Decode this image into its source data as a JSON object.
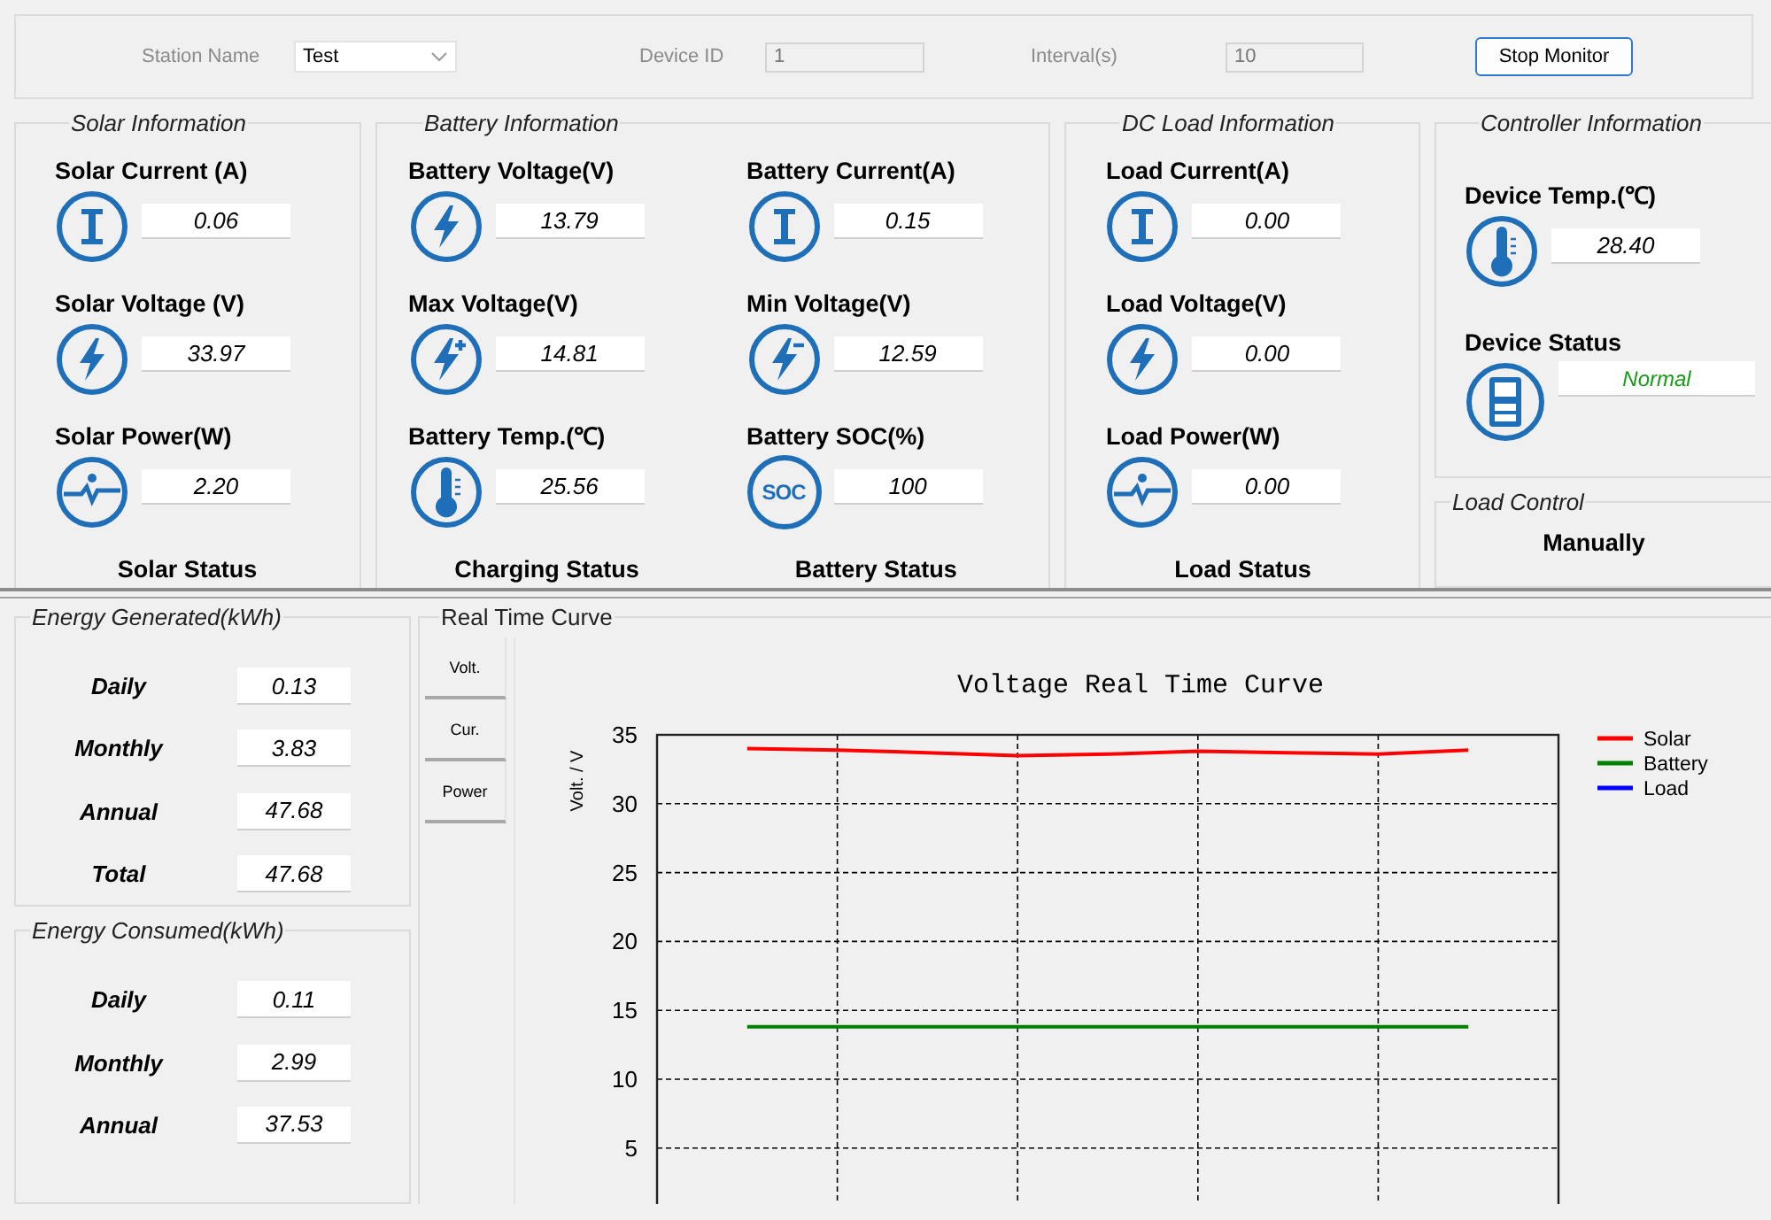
{
  "toolbar": {
    "station_label": "Station Name",
    "station_value": "Test",
    "device_id_label": "Device ID",
    "device_id_value": "1",
    "interval_label": "Interval(s)",
    "interval_value": "10",
    "stop_button": "Stop Monitor"
  },
  "solar": {
    "title": "Solar Information",
    "readings": [
      {
        "label": "Solar Current (A)",
        "value": "0.06",
        "kind": "current"
      },
      {
        "label": "Solar Voltage (V)",
        "value": "33.97",
        "kind": "voltage"
      },
      {
        "label": "Solar Power(W)",
        "value": "2.20",
        "kind": "power"
      }
    ],
    "status_label": "Solar Status"
  },
  "battery": {
    "title": "Battery Information",
    "readings": [
      {
        "label": "Battery Voltage(V)",
        "value": "13.79",
        "kind": "voltage"
      },
      {
        "label": "Battery Current(A)",
        "value": "0.15",
        "kind": "current"
      },
      {
        "label": "Max Voltage(V)",
        "value": "14.81",
        "kind": "voltage_max"
      },
      {
        "label": "Min Voltage(V)",
        "value": "12.59",
        "kind": "voltage_min"
      },
      {
        "label": "Battery Temp.(℃)",
        "value": "25.56",
        "kind": "temperature"
      },
      {
        "label": "Battery SOC(%)",
        "value": "100",
        "kind": "soc",
        "icon_text": "SOC"
      }
    ],
    "status_labels": [
      "Charging Status",
      "Battery Status"
    ]
  },
  "dc_load": {
    "title": "DC Load Information",
    "readings": [
      {
        "label": "Load Current(A)",
        "value": "0.00",
        "kind": "current"
      },
      {
        "label": "Load Voltage(V)",
        "value": "0.00",
        "kind": "voltage"
      },
      {
        "label": "Load Power(W)",
        "value": "0.00",
        "kind": "power"
      }
    ],
    "status_label": "Load Status"
  },
  "controller": {
    "title": "Controller Information",
    "readings": [
      {
        "label": "Device Temp.(℃)",
        "value": "28.40",
        "kind": "temperature"
      },
      {
        "label": "Device Status",
        "value": "Normal",
        "kind": "device"
      }
    ]
  },
  "load_control": {
    "title": "Load Control",
    "mode": "Manually"
  },
  "energy_generated": {
    "title": "Energy Generated(kWh)",
    "rows": [
      {
        "label": "Daily",
        "value": "0.13"
      },
      {
        "label": "Monthly",
        "value": "3.83"
      },
      {
        "label": "Annual",
        "value": "47.68"
      },
      {
        "label": "Total",
        "value": "47.68"
      }
    ]
  },
  "energy_consumed": {
    "title": "Energy Consumed(kWh)",
    "rows": [
      {
        "label": "Daily",
        "value": "0.11"
      },
      {
        "label": "Monthly",
        "value": "2.99"
      },
      {
        "label": "Annual",
        "value": "37.53"
      }
    ]
  },
  "real_time_curve": {
    "title": "Real Time Curve",
    "tabs": [
      "Volt.",
      "Cur.",
      "Power"
    ],
    "chart_data": {
      "type": "line",
      "title": "Voltage Real Time Curve",
      "ylabel": "Volt. / V",
      "categories": [
        null,
        null,
        null,
        null,
        null,
        null,
        null,
        null,
        null
      ],
      "ylim": [
        0,
        35
      ],
      "grid": true,
      "legend": true,
      "yticks": [
        {
          "value": 5,
          "label": "5"
        },
        {
          "value": 10,
          "label": "10"
        },
        {
          "value": 15,
          "label": "15"
        },
        {
          "value": 20,
          "label": "20"
        },
        {
          "value": 25,
          "label": "25"
        },
        {
          "value": 30,
          "label": "30"
        },
        {
          "value": 35,
          "label": "35"
        }
      ],
      "series": [
        {
          "name": "Solar",
          "color": "#ff0000",
          "values": [
            34.0,
            33.9,
            33.7,
            33.5,
            33.6,
            33.8,
            33.7,
            33.6,
            33.9
          ]
        },
        {
          "name": "Battery",
          "color": "#008000",
          "values": [
            13.8,
            13.8,
            13.8,
            13.8,
            13.8,
            13.8,
            13.8,
            13.8,
            13.8
          ]
        },
        {
          "name": "Load",
          "color": "#0000ff",
          "values": [
            null,
            null,
            null,
            null,
            null,
            null,
            null,
            null,
            null
          ]
        }
      ]
    }
  }
}
